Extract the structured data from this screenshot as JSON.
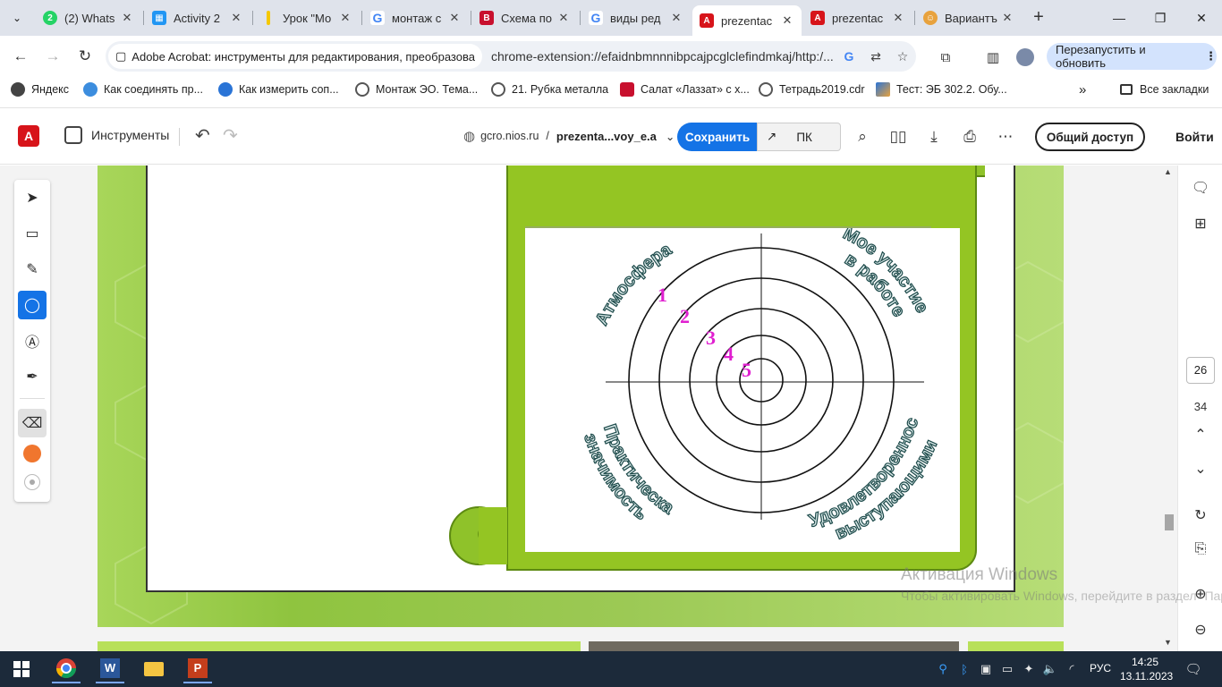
{
  "tabs": [
    {
      "title": "(2) Whats",
      "color": "#25d366"
    },
    {
      "title": "Activity 2",
      "color": "#2196f3"
    },
    {
      "title": "Урок \"Мо",
      "color": "#f5c800"
    },
    {
      "title": "монтаж с",
      "color": "#4285f4"
    },
    {
      "title": "Схема по",
      "color": "#c8102e"
    },
    {
      "title": "виды ред",
      "color": "#4285f4"
    },
    {
      "title": "prezentac",
      "color": "#d7141a",
      "active": true
    },
    {
      "title": "prezentac",
      "color": "#d7141a"
    },
    {
      "title": "Вариантъ",
      "color": "#e8a23d"
    }
  ],
  "address": {
    "chip": "Adobe Acrobat: инструменты для редактирования, преобразова",
    "url": "chrome-extension://efaidnbmnnnibpcajpcglclefindmkaj/http:/...",
    "relaunch": "Перезапустить и обновить"
  },
  "bookmarks": [
    {
      "label": "Яндекс",
      "color": "#333"
    },
    {
      "label": "Как соединять пр...",
      "color": "#3c8dde"
    },
    {
      "label": "Как измерить соп...",
      "color": "#2a74d6"
    },
    {
      "label": "Монтаж ЭО. Тема...",
      "color": "#555"
    },
    {
      "label": "21. Рубка металла",
      "color": "#555"
    },
    {
      "label": "Салат «Лаззат» с х...",
      "color": "#c8102e"
    },
    {
      "label": "Тетрадь2019.cdr",
      "color": "#555"
    },
    {
      "label": "Тест: ЭБ 302.2. Обу...",
      "color": "#2a74d6"
    }
  ],
  "bookmarks_all": "Все закладки",
  "acrobat": {
    "tools": "Инструменты",
    "site": "gcro.nios.ru",
    "sep": "/",
    "doc": "prezenta...voy_e.a",
    "save": "Сохранить",
    "pc": "ПК",
    "share": "Общий доступ",
    "signin": "Войти"
  },
  "viewer": {
    "page_current": "26",
    "page_total": "34"
  },
  "slide": {
    "sector_labels": [
      "Атмосфера",
      "Мое участие",
      "в работе",
      "Практическая",
      "значимость",
      "Удовлетворенность",
      "выступающими"
    ],
    "ring_numbers": [
      "1",
      "2",
      "3",
      "4",
      "5"
    ],
    "number_color": "#e020d0",
    "label_color": "#1d4a4a"
  },
  "watermark": {
    "line1": "Активация Windows",
    "line2": "Чтобы активировать Windows, перейдите в раздел \"Параметры\"."
  },
  "taskbar": {
    "time": "14:25",
    "date": "13.11.2023",
    "lang": "РУС"
  }
}
